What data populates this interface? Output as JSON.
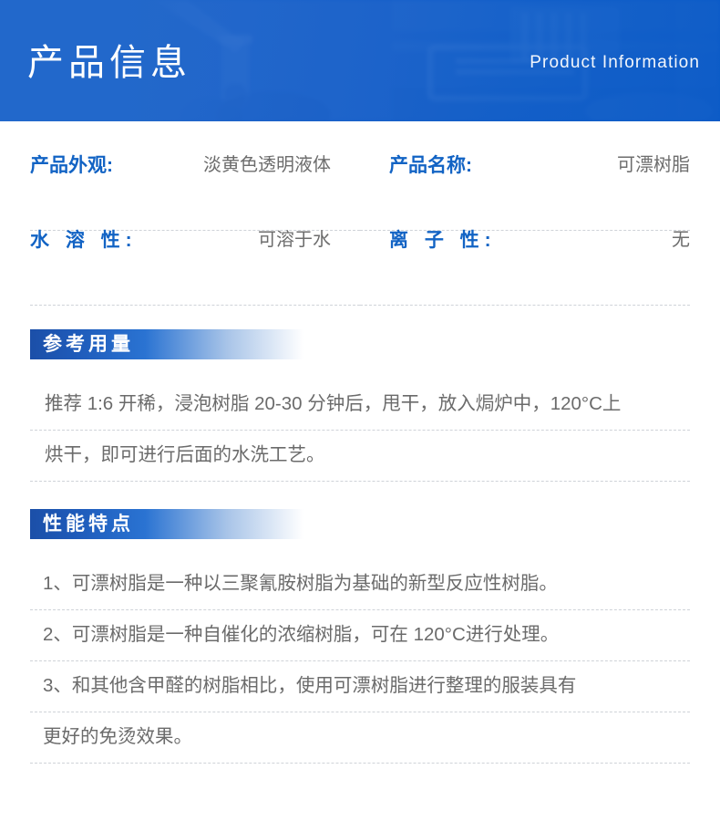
{
  "banner": {
    "title_cn": "产品信息",
    "title_en": "Product Information",
    "bg_color": "#2268cb",
    "text_color": "#ffffff"
  },
  "colors": {
    "accent_blue": "#1263c4",
    "label_blue": "#1263c4",
    "value_gray": "#6d6d6d",
    "body_gray": "#6b6b6b",
    "dash_gray": "#cfd3d8",
    "bar_gradient_start": "#1b4fa8",
    "bar_gradient_end": "#ffffff"
  },
  "specs": [
    {
      "label": "产品外观:",
      "value": "淡黄色透明液体",
      "spaced": false
    },
    {
      "label": "产品名称:",
      "value": "可漂树脂",
      "spaced": false
    },
    {
      "label": "水 溶 性:",
      "value": "可溶于水",
      "spaced": true
    },
    {
      "label": "离 子 性:",
      "value": "无",
      "spaced": true
    }
  ],
  "sections": [
    {
      "heading": "参考用量",
      "lines": [
        "推荐 1:6 开稀，浸泡树脂 20-30 分钟后，甩干，放入焗炉中，120°C上",
        "烘干，即可进行后面的水洗工艺。"
      ]
    },
    {
      "heading": "性能特点",
      "lines": [
        "1、可漂树脂是一种以三聚氰胺树脂为基础的新型反应性树脂。",
        "2、可漂树脂是一种自催化的浓缩树脂，可在 120°C进行处理。",
        "3、和其他含甲醛的树脂相比，使用可漂树脂进行整理的服装具有",
        "更好的免烫效果。"
      ]
    }
  ]
}
